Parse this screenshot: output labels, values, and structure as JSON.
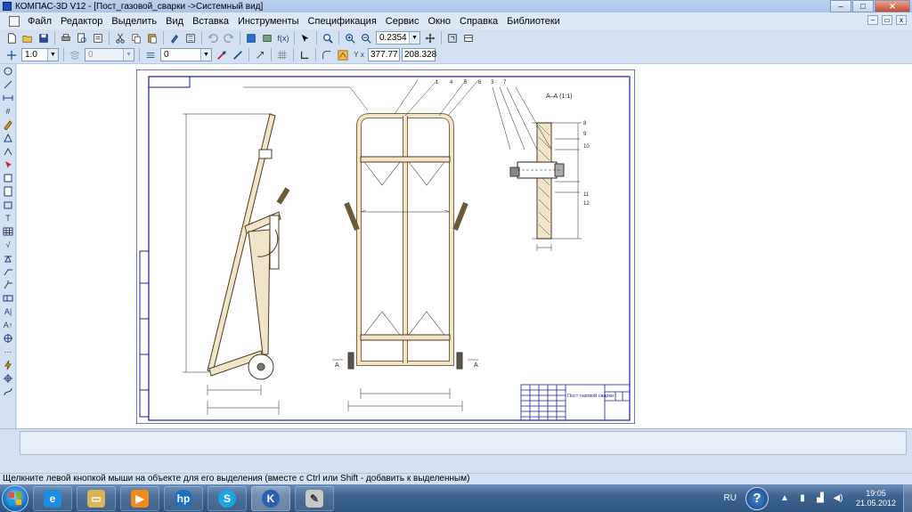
{
  "window": {
    "title": "КОМПАС-3D V12 - [Пост_газовой_сварки ->Системный вид]",
    "controls": {
      "minimize": "–",
      "maximize": "□",
      "close": "✕"
    }
  },
  "menu": {
    "items": [
      "Файл",
      "Редактор",
      "Выделить",
      "Вид",
      "Вставка",
      "Инструменты",
      "Спецификация",
      "Сервис",
      "Окно",
      "Справка",
      "Библиотеки"
    ],
    "mdi_controls": {
      "minimize": "–",
      "restore": "▭",
      "close": "x"
    }
  },
  "toolbar_main": {
    "zoom_value": "0.2354"
  },
  "toolbar_current": {
    "step_value": "1.0",
    "layer_value": "0",
    "style_value": "0",
    "coord_x": "377.77",
    "coord_y": "208.328"
  },
  "drawing": {
    "section_label": "А–А (1:1)",
    "arrow_label_left": "А",
    "arrow_label_right": "А",
    "leader_numbers": [
      "1",
      "4",
      "5",
      "6",
      "3",
      "7"
    ],
    "side_numbers": [
      "8",
      "9",
      "10",
      "11",
      "12"
    ],
    "title_block_name": "Пост газовой сварки"
  },
  "colors": {
    "frame": "#1c1ca8",
    "part_outline": "#4a3a20",
    "part_fill": "#f1e4c9",
    "dimension": "#222222"
  },
  "statusbar": {
    "hint": "Щелкните левой кнопкой мыши на объекте для его выделения (вместе с Ctrl или Shift - добавить к выделенным)"
  },
  "taskbar": {
    "language": "RU",
    "time": "19:05",
    "date": "21.05.2012"
  }
}
